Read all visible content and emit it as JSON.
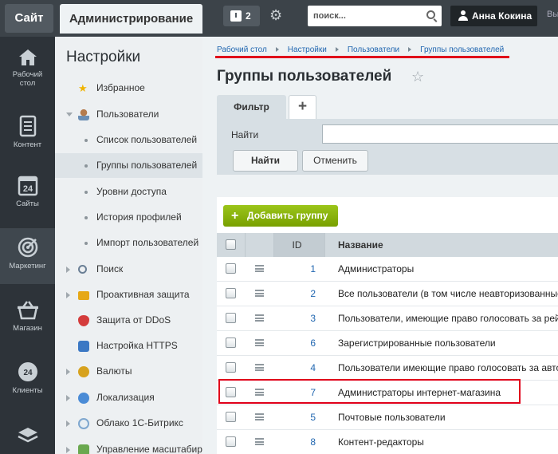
{
  "topbar": {
    "site_label": "Сайт",
    "admin_label": "Администрирование",
    "notifications_count": "2",
    "search_placeholder": "поиск...",
    "user_name": "Анна Кокина",
    "more_label": "Вы"
  },
  "rail": {
    "items": [
      {
        "label": "Рабочий стол",
        "icon": "home-icon"
      },
      {
        "label": "Контент",
        "icon": "document-icon"
      },
      {
        "label": "Сайты",
        "icon": "calendar-icon",
        "icon_text": "24"
      },
      {
        "label": "Маркетинг",
        "icon": "target-icon"
      },
      {
        "label": "Магазин",
        "icon": "basket-icon"
      },
      {
        "label": "Клиенты",
        "icon": "clients-icon",
        "icon_text": "24"
      },
      {
        "label": "",
        "icon": "layers-icon"
      }
    ]
  },
  "sidebar": {
    "title": "Настройки",
    "items": [
      {
        "label": "Избранное",
        "type": "star"
      },
      {
        "label": "Пользователи",
        "type": "users",
        "expanded": true
      },
      {
        "label": "Список пользователей",
        "type": "sub"
      },
      {
        "label": "Группы пользователей",
        "type": "sub",
        "active": true
      },
      {
        "label": "Уровни доступа",
        "type": "sub"
      },
      {
        "label": "История профилей",
        "type": "sub"
      },
      {
        "label": "Импорт пользователей",
        "type": "sub"
      },
      {
        "label": "Поиск",
        "type": "search"
      },
      {
        "label": "Проактивная защита",
        "type": "lock"
      },
      {
        "label": "Защита от DDoS",
        "type": "shield"
      },
      {
        "label": "Настройка HTTPS",
        "type": "https"
      },
      {
        "label": "Валюты",
        "type": "currency"
      },
      {
        "label": "Локализация",
        "type": "globe"
      },
      {
        "label": "Облако 1С-Битрикс",
        "type": "cloud"
      },
      {
        "label": "Управление масштабир",
        "type": "scale"
      }
    ]
  },
  "breadcrumb": [
    "Рабочий стол",
    "Настройки",
    "Пользователи",
    "Группы пользователей"
  ],
  "page_title": "Группы пользователей",
  "filter": {
    "tab_label": "Фильтр",
    "add_tab_label": "+",
    "find_label": "Найти",
    "find_value": "",
    "find_button": "Найти",
    "cancel_button": "Отменить"
  },
  "grid": {
    "add_button": "Добавить группу",
    "columns": {
      "id": "ID",
      "name": "Название"
    },
    "rows": [
      {
        "id": "1",
        "name": "Администраторы"
      },
      {
        "id": "2",
        "name": "Все пользователи (в том числе неавторизованные)"
      },
      {
        "id": "3",
        "name": "Пользователи, имеющие право голосовать за рейтинг"
      },
      {
        "id": "6",
        "name": "Зарегистрированные пользователи"
      },
      {
        "id": "4",
        "name": "Пользователи имеющие право голосовать за авторитет"
      },
      {
        "id": "7",
        "name": "Администраторы интернет-магазина",
        "highlighted": true
      },
      {
        "id": "5",
        "name": "Почтовые пользователи"
      },
      {
        "id": "8",
        "name": "Контент-редакторы"
      }
    ]
  },
  "colors": {
    "accent_red": "#e0001a",
    "link_blue": "#2066b0",
    "add_button_green": "#86ad00"
  }
}
